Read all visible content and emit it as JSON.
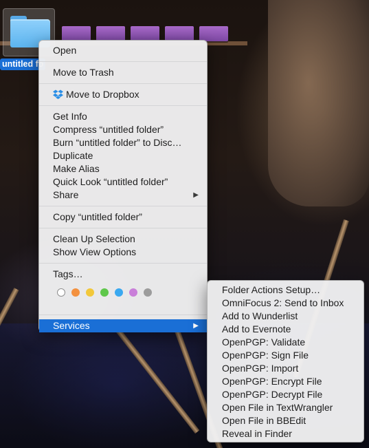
{
  "desktop": {
    "folder_label": "untitled fo"
  },
  "context_menu": {
    "open": "Open",
    "move_to_trash": "Move to Trash",
    "move_to_dropbox": "Move to Dropbox",
    "get_info": "Get Info",
    "compress": "Compress “untitled folder”",
    "burn": "Burn “untitled folder” to Disc…",
    "duplicate": "Duplicate",
    "make_alias": "Make Alias",
    "quick_look": "Quick Look “untitled folder”",
    "share": "Share",
    "copy": "Copy “untitled folder”",
    "clean_up_selection": "Clean Up Selection",
    "show_view_options": "Show View Options",
    "tags": "Tags…",
    "tag_colors": [
      {
        "name": "none",
        "fill": "#ffffff",
        "border": "#8e8e8e"
      },
      {
        "name": "orange",
        "fill": "#f3913f",
        "border": "#f3913f"
      },
      {
        "name": "yellow",
        "fill": "#f2c83b",
        "border": "#f2c83b"
      },
      {
        "name": "green",
        "fill": "#5fc74b",
        "border": "#5fc74b"
      },
      {
        "name": "blue",
        "fill": "#3aa8f0",
        "border": "#3aa8f0"
      },
      {
        "name": "purple",
        "fill": "#c97fd9",
        "border": "#c97fd9"
      },
      {
        "name": "gray",
        "fill": "#9c9c9c",
        "border": "#9c9c9c"
      }
    ],
    "services": "Services",
    "submenu_arrow": "▶",
    "highlight_color": "#1a6fd6"
  },
  "services_submenu": {
    "items": [
      "Folder Actions Setup…",
      "OmniFocus 2: Send to Inbox",
      "Add to Wunderlist",
      "Add to Evernote",
      "OpenPGP: Validate",
      "OpenPGP: Sign File",
      "OpenPGP: Import",
      "OpenPGP: Encrypt File",
      "OpenPGP: Decrypt File",
      "Open File in TextWrangler",
      "Open File in BBEdit",
      "Reveal in Finder"
    ]
  }
}
